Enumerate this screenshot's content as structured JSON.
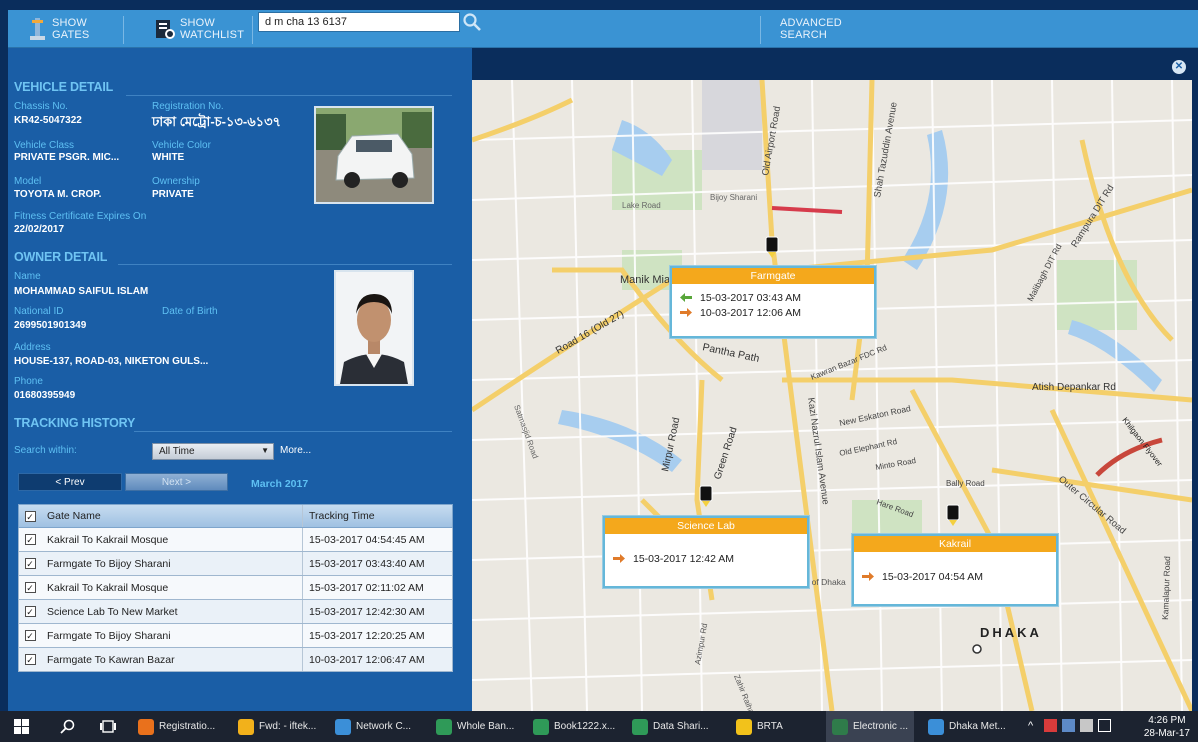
{
  "toolbar": {
    "show_gates": [
      "SHOW",
      "GATES"
    ],
    "show_watchlist": [
      "SHOW",
      "WATCHLIST"
    ],
    "search_value": "d m cha 13 6137",
    "advanced_search": [
      "ADVANCED",
      "SEARCH"
    ]
  },
  "vehicle": {
    "section_title": "VEHICLE DETAIL",
    "chassis_label": "Chassis No.",
    "chassis_value": "KR42-5047322",
    "reg_label": "Registration No.",
    "reg_value": "ঢাকা মেট্রো-চ-১৩-৬১৩৭",
    "class_label": "Vehicle Class",
    "class_value": "PRIVATE PSGR. MIC...",
    "color_label": "Vehicle Color",
    "color_value": "WHITE",
    "model_label": "Model",
    "model_value": "TOYOTA M. CROP.",
    "ownership_label": "Ownership",
    "ownership_value": "PRIVATE",
    "fitness_label": "Fitness Certificate Expires On",
    "fitness_value": "22/02/2017"
  },
  "owner": {
    "section_title": "OWNER DETAIL",
    "name_label": "Name",
    "name_value": "MOHAMMAD SAIFUL ISLAM",
    "nid_label": "National ID",
    "nid_value": "2699501901349",
    "dob_label": "Date of Birth",
    "address_label": "Address",
    "address_value": "HOUSE-137, ROAD-03, NIKETON GULS...",
    "phone_label": "Phone",
    "phone_value": "01680395949"
  },
  "tracking": {
    "section_title": "TRACKING HISTORY",
    "search_within_label": "Search within:",
    "search_within_value": "All Time",
    "more_label": "More...",
    "prev_label": "< Prev",
    "next_label": "Next >",
    "month_label": "March 2017",
    "col_gate": "Gate Name",
    "col_time": "Tracking Time",
    "rows": [
      {
        "gate": "Kakrail To Kakrail Mosque",
        "time": "15-03-2017 04:54:45 AM"
      },
      {
        "gate": "Farmgate To Bijoy Sharani",
        "time": "15-03-2017 03:43:40 AM"
      },
      {
        "gate": "Kakrail To Kakrail Mosque",
        "time": "15-03-2017 02:11:02 AM"
      },
      {
        "gate": "Science Lab To New Market",
        "time": "15-03-2017 12:42:30 AM"
      },
      {
        "gate": "Farmgate To Bijoy Sharani",
        "time": "15-03-2017 12:20:25 AM"
      },
      {
        "gate": "Farmgate To Kawran Bazar",
        "time": "10-03-2017 12:06:47 AM"
      }
    ]
  },
  "map": {
    "popups": [
      {
        "title": "Farmgate",
        "entries": [
          "15-03-2017 03:43 AM",
          "10-03-2017 12:06 AM"
        ]
      },
      {
        "title": "Science Lab",
        "entries": [
          "15-03-2017 12:42 AM"
        ]
      },
      {
        "title": "Kakrail",
        "entries": [
          "15-03-2017 04:54 AM"
        ]
      }
    ],
    "labels": {
      "manik_miah": "Manik Miah",
      "panthapath": "Pantha Path",
      "mirpur": "Mirpur Road",
      "green": "Green Road",
      "road16": "Road 16 (Old 27)",
      "dhaka": "DHAKA",
      "airport": "Old Airport Road",
      "tejgaon": "Shah Tazuddin Avenue",
      "rampura": "Rampura DIT Rd",
      "kazi": "Kazi Nazrul Islam Avenue",
      "atish": "Atish Depankar Rd",
      "outer": "Outer Circular Road",
      "eskaton": "New Eskaton Road",
      "univ": "University of Dhaka",
      "bijoy": "Bijoy Sharani",
      "lake": "Lake Road",
      "kawran": "Kawran Bazar FDC Rd",
      "mallibagh": "Malibagh DIT Rd",
      "bally": "Bally Road",
      "hare": "Hare Road",
      "minto": "Minto Road",
      "elephant": "Old Elephant Rd",
      "kamalapur": "Kamalapur Road",
      "flyover": "Khilgaon Flyover",
      "azimpur": "Azimpur Rd",
      "zahir": "Zahir Raihan Sharani Rd",
      "satmasjid": "Satmasjid Road"
    }
  },
  "taskbar": {
    "items": [
      "Registratio...",
      "Fwd: - iftek...",
      "Network C...",
      "Whole Ban...",
      "Book1222.x...",
      "Data Shari...",
      "BRTA",
      "Electronic ...",
      "Dhaka Met..."
    ],
    "time": "4:26 PM",
    "date": "28-Mar-17"
  }
}
